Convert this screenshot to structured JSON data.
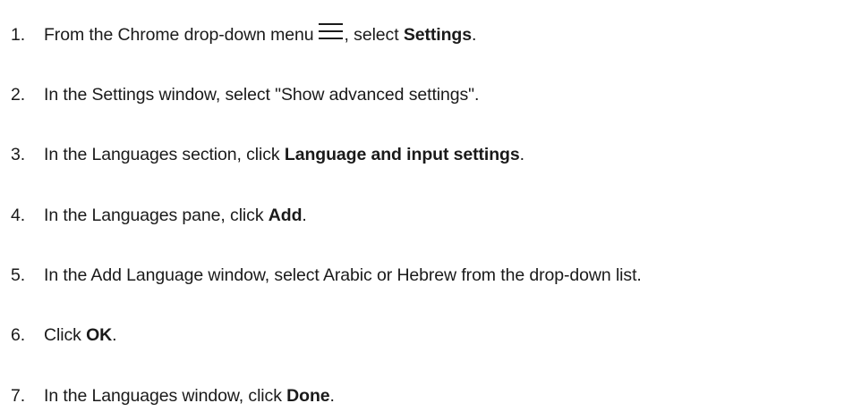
{
  "steps": [
    {
      "num": "1.",
      "before": "From the Chrome drop-down menu",
      "icon": "menu-icon",
      "middle": ", select ",
      "bold": "Settings",
      "after": "."
    },
    {
      "num": "2.",
      "text": "In the Settings window, select \"Show advanced settings\"."
    },
    {
      "num": "3.",
      "before": "In the Languages section, click ",
      "bold": "Language and input settings",
      "after": "."
    },
    {
      "num": "4.",
      "before": "In the Languages pane, click ",
      "bold": "Add",
      "after": "."
    },
    {
      "num": "5.",
      "text": "In the Add Language window, select Arabic or Hebrew from the drop-down list."
    },
    {
      "num": "6.",
      "before": "Click ",
      "bold": "OK",
      "after": "."
    },
    {
      "num": "7.",
      "before": "In the Languages window, click ",
      "bold": "Done",
      "after": "."
    }
  ]
}
